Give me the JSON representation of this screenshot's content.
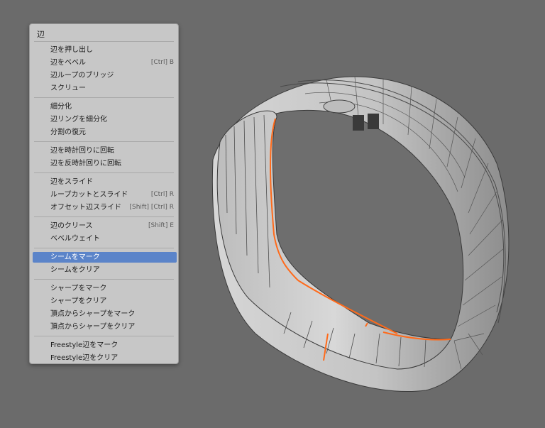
{
  "menu": {
    "title": "辺",
    "groups": [
      [
        {
          "label": "辺を押し出し",
          "shortcut": ""
        },
        {
          "label": "辺をベベル",
          "shortcut": "[Ctrl] B"
        },
        {
          "label": "辺ループのブリッジ",
          "shortcut": ""
        },
        {
          "label": "スクリュー",
          "shortcut": ""
        }
      ],
      [
        {
          "label": "細分化",
          "shortcut": ""
        },
        {
          "label": "辺リングを細分化",
          "shortcut": ""
        },
        {
          "label": "分割の復元",
          "shortcut": ""
        }
      ],
      [
        {
          "label": "辺を時計回りに回転",
          "shortcut": ""
        },
        {
          "label": "辺を反時計回りに回転",
          "shortcut": ""
        }
      ],
      [
        {
          "label": "辺をスライド",
          "shortcut": ""
        },
        {
          "label": "ループカットとスライド",
          "shortcut": "[Ctrl] R"
        },
        {
          "label": "オフセット辺スライド",
          "shortcut": "[Shift] [Ctrl] R"
        }
      ],
      [
        {
          "label": "辺のクリース",
          "shortcut": "[Shift] E"
        },
        {
          "label": "ベベルウェイト",
          "shortcut": ""
        }
      ],
      [
        {
          "label": "シームをマーク",
          "shortcut": ""
        },
        {
          "label": "シームをクリア",
          "shortcut": ""
        }
      ],
      [
        {
          "label": "シャープをマーク",
          "shortcut": ""
        },
        {
          "label": "シャープをクリア",
          "shortcut": ""
        },
        {
          "label": "頂点からシャープをマーク",
          "shortcut": ""
        },
        {
          "label": "頂点からシャープをクリア",
          "shortcut": ""
        }
      ],
      [
        {
          "label": "Freestyle辺をマーク",
          "shortcut": ""
        },
        {
          "label": "Freestyle辺をクリア",
          "shortcut": ""
        }
      ]
    ],
    "selected_label": "シームをマーク"
  },
  "colors": {
    "viewport_bg": "#6b6b6b",
    "menu_bg": "#c7c7c7",
    "highlight": "#5b84c9",
    "seam": "#ff6a1a"
  }
}
